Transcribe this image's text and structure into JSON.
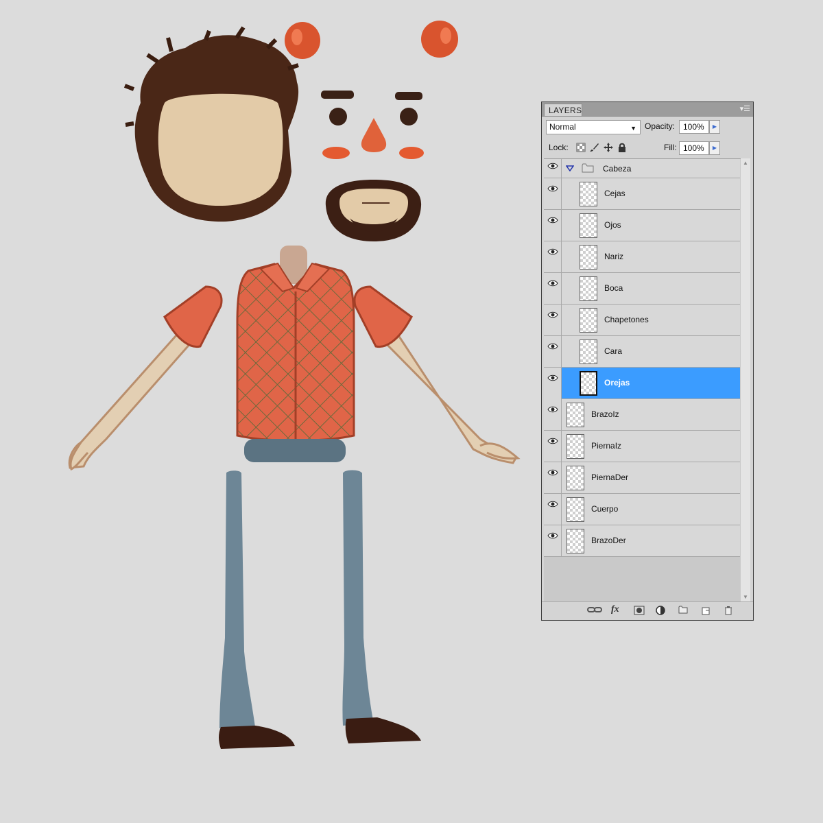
{
  "layers_panel": {
    "tab_label": "LAYERS",
    "blend_mode": "Normal",
    "opacity_label": "Opacity:",
    "opacity_value": "100%",
    "lock_label": "Lock:",
    "fill_label": "Fill:",
    "fill_value": "100%",
    "group": {
      "name": "Cabeza",
      "expanded": true
    },
    "group_layers": [
      {
        "name": "Cejas",
        "selected": false
      },
      {
        "name": "Ojos",
        "selected": false
      },
      {
        "name": "Nariz",
        "selected": false
      },
      {
        "name": "Boca",
        "selected": false
      },
      {
        "name": "Chapetones",
        "selected": false
      },
      {
        "name": "Cara",
        "selected": false
      },
      {
        "name": "Orejas",
        "selected": true
      }
    ],
    "layers": [
      {
        "name": "BrazoIz"
      },
      {
        "name": "PiernaIz"
      },
      {
        "name": "PiernaDer"
      },
      {
        "name": "Cuerpo"
      },
      {
        "name": "BrazoDer"
      }
    ],
    "colors": {
      "selection": "#3b9cff",
      "panel": "#d4d4d4"
    },
    "bottom_icons": [
      "link-icon",
      "fx-icon",
      "mask-icon",
      "adjustment-icon",
      "folder-icon",
      "new-layer-icon",
      "trash-icon"
    ]
  }
}
